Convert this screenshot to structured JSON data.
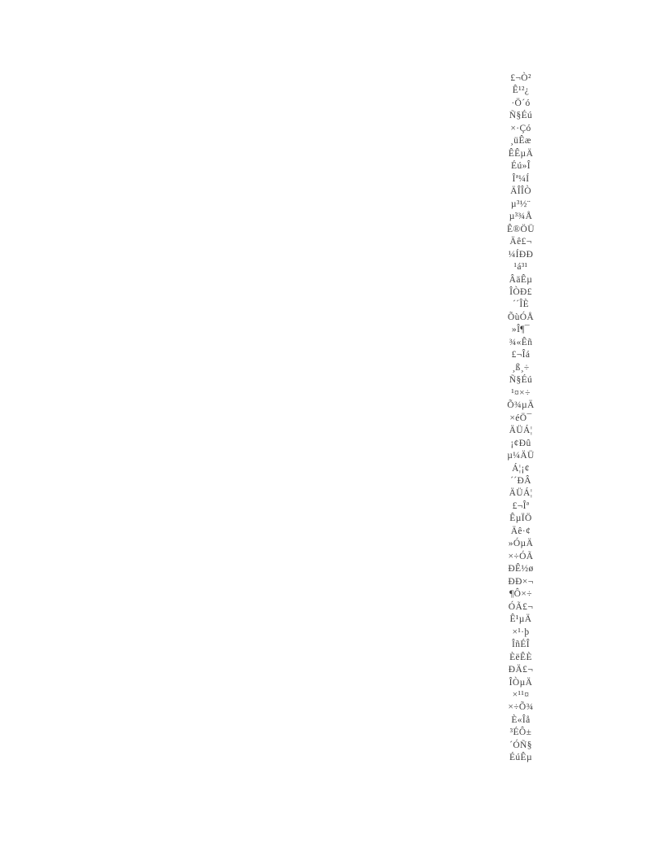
{
  "document": {
    "page_background": "#ffffff",
    "text_color": "#3d3d3d",
    "column_alignment": "center",
    "lines": [
      "£¬Ò²",
      "Ê¹²¿",
      "·Ö´ó",
      "Ñ§Éú",
      "×·Çó",
      "¸üÊæ",
      "ÊÊµÄ",
      "Éú»Î",
      "Îª¼Í",
      "ÄÎÎÒ",
      "µ³½¨",
      "µ³¾Å",
      "Ê®ÖÜ",
      "Äê£¬",
      "¼ÍÐÐ",
      "¹á³¹",
      "ÂäÊµ",
      "ÎÒÐ£",
      "´´ÎÈ",
      "ÕùÓÅ",
      "»Î¶¯",
      "¾«Êñ",
      "£¬Îá",
      "¸ß¸÷",
      "Ñ§Éú",
      "¹¤×÷",
      "Õ¾µÄ",
      "×éÖ¯",
      "ÄÜÁ¦",
      "¡¢Ðû",
      "µ¼ÄÜ",
      "Á¦¡¢",
      "´´ÐÂ",
      "ÄÜÁ¦",
      "£¬Îª",
      "ÊµÏÖ",
      "Äê·¢",
      "»ÓµÄ",
      "×÷ÓÃ",
      "ÐÊ½ø",
      "ÐÐ×¬",
      "¶Ô×÷",
      "ÓÃ£¬",
      "Ê¹µÄ",
      "×¹·þ",
      "ÎñÉÎ",
      "ÈëÊÈ",
      "ÐÄ£¬",
      "ÎÒµÄ",
      "×¹¹¤",
      "×÷Õ¾",
      "È«Îå",
      "³ÉÔ±",
      "´ÓÑ§",
      "ÉúÊµ"
    ]
  }
}
